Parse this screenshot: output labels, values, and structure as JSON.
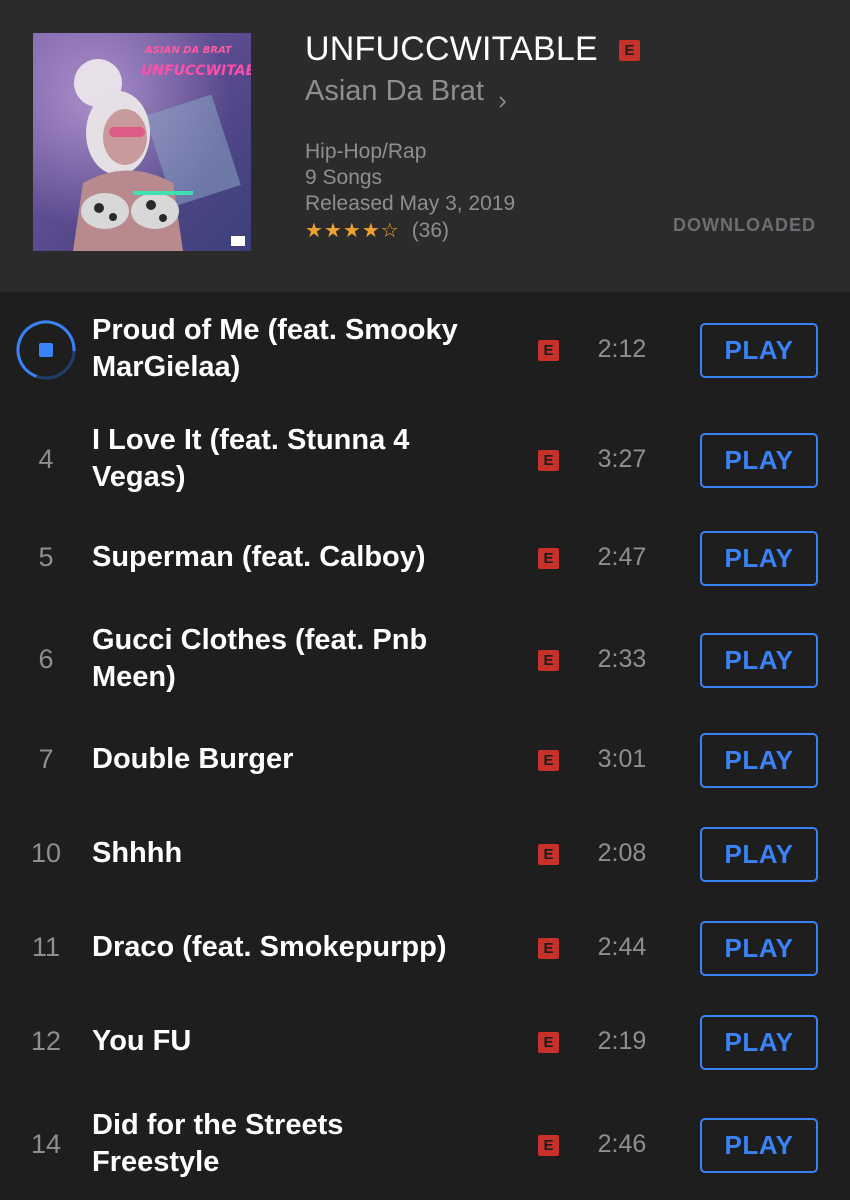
{
  "album": {
    "title": "UNFUCCWITABLE",
    "explicit_badge": "E",
    "artist": "Asian Da Brat",
    "genre": "Hip-Hop/Rap",
    "song_count": "9 Songs",
    "released": "Released May 3, 2019",
    "rating_stars": 4,
    "rating_max": 5,
    "rating_count": "(36)",
    "status": "DOWNLOADED",
    "cover_text_top": "ASIAN DA BRAT",
    "cover_text_main": "UNFUCCWITABLE"
  },
  "colors": {
    "accent": "#3a82f7",
    "explicit": "#c8302a",
    "star": "#f0a030",
    "header_bg": "#2b2b2b",
    "list_bg": "#1e1e1e"
  },
  "tracks": [
    {
      "number": "",
      "title_line1": "Proud of Me (feat. Smooky",
      "title_line2": "MarGielaa)",
      "duration": "2:12",
      "explicit": "E",
      "button": "PLAY",
      "playing": true,
      "progress": 0.3
    },
    {
      "number": "4",
      "title_line1": "I Love It (feat. Stunna 4",
      "title_line2": "Vegas)",
      "duration": "3:27",
      "explicit": "E",
      "button": "PLAY"
    },
    {
      "number": "5",
      "title_line1": "Superman (feat. Calboy)",
      "title_line2": "",
      "duration": "2:47",
      "explicit": "E",
      "button": "PLAY"
    },
    {
      "number": "6",
      "title_line1": "Gucci Clothes (feat. Pnb",
      "title_line2": "Meen)",
      "duration": "2:33",
      "explicit": "E",
      "button": "PLAY"
    },
    {
      "number": "7",
      "title_line1": "Double Burger",
      "title_line2": "",
      "duration": "3:01",
      "explicit": "E",
      "button": "PLAY"
    },
    {
      "number": "10",
      "title_line1": "Shhhh",
      "title_line2": "",
      "duration": "2:08",
      "explicit": "E",
      "button": "PLAY"
    },
    {
      "number": "11",
      "title_line1": "Draco (feat. Smokepurpp)",
      "title_line2": "",
      "duration": "2:44",
      "explicit": "E",
      "button": "PLAY"
    },
    {
      "number": "12",
      "title_line1": "You FU",
      "title_line2": "",
      "duration": "2:19",
      "explicit": "E",
      "button": "PLAY"
    },
    {
      "number": "14",
      "title_line1": "Did for the Streets",
      "title_line2": "Freestyle",
      "duration": "2:46",
      "explicit": "E",
      "button": "PLAY"
    }
  ]
}
